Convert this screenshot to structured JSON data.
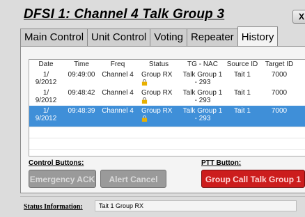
{
  "window": {
    "title": "DFSI 1: Channel 4 Talk Group 3",
    "close_label": "X"
  },
  "tabs": [
    {
      "label": "Main Control",
      "active": false
    },
    {
      "label": "Unit Control",
      "active": false
    },
    {
      "label": "Voting",
      "active": false
    },
    {
      "label": "Repeater",
      "active": false
    },
    {
      "label": "History",
      "active": true
    }
  ],
  "table": {
    "columns": [
      "Date",
      "Time",
      "Freq",
      "Status",
      "TG - NAC",
      "Source ID",
      "Target ID"
    ],
    "rows": [
      {
        "date": "1/ 9/2012",
        "time": "09:49:00",
        "freq": "Channel 4",
        "status": "Group RX",
        "tg_nac": "Talk Group 1 - 293",
        "source": "Tait 1",
        "target": "7000",
        "selected": false
      },
      {
        "date": "1/ 9/2012",
        "time": "09:48:42",
        "freq": "Channel 4",
        "status": "Group RX",
        "tg_nac": "Talk Group 1 - 293",
        "source": "Tait 1",
        "target": "7000",
        "selected": false
      },
      {
        "date": "1/ 9/2012",
        "time": "09:48:39",
        "freq": "Channel 4",
        "status": "Group RX",
        "tg_nac": "Talk Group 1 - 293",
        "source": "Tait 1",
        "target": "7000",
        "selected": true
      }
    ],
    "status_icon": "lock-icon"
  },
  "control_buttons": {
    "label": "Control Buttons:",
    "emergency_ack": "Emergency ACK",
    "alert_cancel": "Alert Cancel"
  },
  "ptt": {
    "label": "PTT Button:",
    "button": "Group Call Talk Group 1"
  },
  "status": {
    "label": "Status Information:",
    "value": "Tait 1 Group RX"
  },
  "colors": {
    "selection": "#3f8fd8",
    "ptt_red": "#cc1d1d",
    "disabled_grey": "#9a9a9a"
  }
}
